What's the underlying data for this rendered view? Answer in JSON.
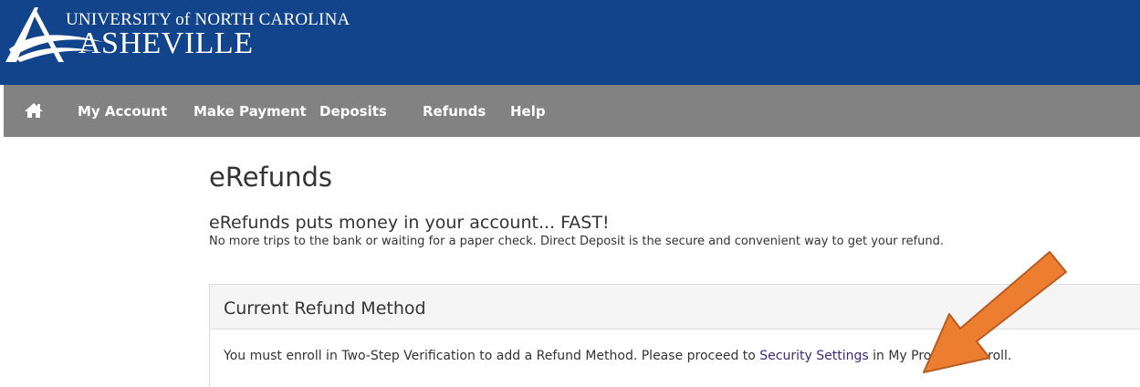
{
  "header": {
    "logo_line1": "UNIVERSITY of NORTH CAROLINA",
    "logo_line2": "ASHEVILLE",
    "background_color": "#12448c"
  },
  "navbar": {
    "home_icon": "home-icon",
    "items": [
      {
        "label": "My Account"
      },
      {
        "label": "Make Payment"
      },
      {
        "label": "Deposits"
      },
      {
        "label": "Refunds"
      },
      {
        "label": "Help"
      }
    ],
    "background_color": "#828282"
  },
  "main": {
    "title": "eRefunds",
    "subheading": "eRefunds puts money in your account... FAST!",
    "subtext": "No more trips to the bank or waiting for a paper check. Direct Deposit is the secure and convenient way to get your refund.",
    "panel": {
      "title": "Current Refund Method",
      "body_before": "You must enroll in Two-Step Verification to add a Refund Method. Please proceed to ",
      "link_text": "Security Settings",
      "body_after": " in My Profile to enroll."
    }
  },
  "annotation": {
    "arrow_icon": "arrow-annotation-icon",
    "arrow_color": "#ed7d31"
  }
}
